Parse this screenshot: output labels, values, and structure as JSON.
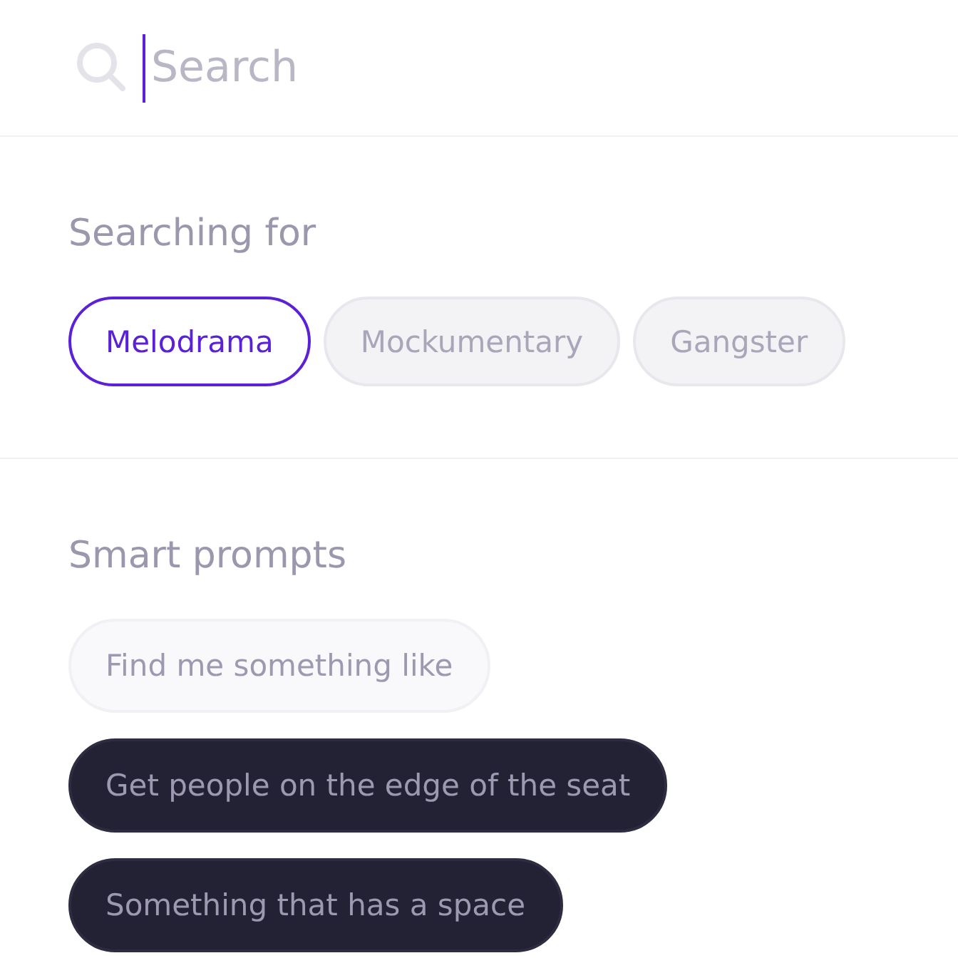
{
  "search": {
    "placeholder": "Search",
    "focused": true
  },
  "searching_for": {
    "title": "Searching for",
    "chips": [
      {
        "label": "Melodrama",
        "selected": true
      },
      {
        "label": "Mockumentary",
        "selected": false
      },
      {
        "label": "Gangster",
        "selected": false
      }
    ]
  },
  "smart_prompts": {
    "title": "Smart prompts",
    "prompts": [
      {
        "label": "Find me something like",
        "kind": "light"
      },
      {
        "label": "Get people on the edge of the seat",
        "kind": "dark"
      },
      {
        "label": "Something that has a space",
        "kind": "dark"
      }
    ]
  }
}
